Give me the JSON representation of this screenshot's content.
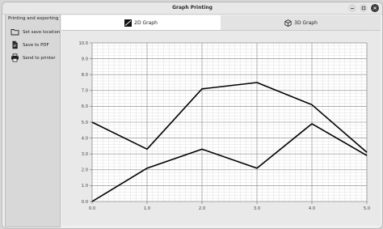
{
  "window": {
    "title": "Graph Printing"
  },
  "sidebar": {
    "heading": "Printing and exporting",
    "items": [
      {
        "label": "Set save location",
        "icon": "folder-icon"
      },
      {
        "label": "Save to PDF",
        "icon": "document-icon"
      },
      {
        "label": "Send to printer",
        "icon": "printer-icon"
      }
    ]
  },
  "tabs": [
    {
      "label": "2D Graph",
      "icon": "graph-2d-icon",
      "active": true
    },
    {
      "label": "3D Graph",
      "icon": "cube-icon",
      "active": false
    }
  ],
  "chart_data": {
    "type": "line",
    "x_ticks": [
      "0.0",
      "1.0",
      "2.0",
      "3.0",
      "4.0",
      "5.0"
    ],
    "y_ticks": [
      "0.0",
      "1.0",
      "2.0",
      "3.0",
      "4.0",
      "5.0",
      "6.0",
      "7.0",
      "8.0",
      "9.0",
      "10.0"
    ],
    "xlim": [
      0,
      5
    ],
    "ylim": [
      0,
      10
    ],
    "grid": true,
    "series": [
      {
        "x": [
          0,
          1,
          2,
          3,
          4,
          5
        ],
        "y": [
          5.0,
          3.3,
          7.1,
          7.5,
          6.1,
          3.1
        ]
      },
      {
        "x": [
          0,
          1,
          2,
          3,
          4,
          5
        ],
        "y": [
          0.0,
          2.1,
          3.3,
          2.1,
          4.9,
          2.9
        ]
      }
    ],
    "line_color": "#000000"
  }
}
